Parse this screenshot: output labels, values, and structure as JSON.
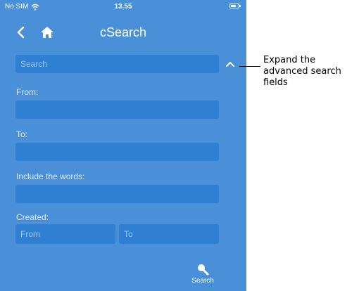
{
  "status_bar": {
    "carrier": "No SIM",
    "time": "13.55"
  },
  "nav": {
    "title": "cSearch"
  },
  "search": {
    "placeholder": "Search"
  },
  "form": {
    "from_label": "From:",
    "to_label": "To:",
    "include_label": "Include the words:",
    "created_label": "Created:",
    "created_from_placeholder": "From",
    "created_to_placeholder": "To"
  },
  "toolbar": {
    "search_label": "Search"
  },
  "annotation": {
    "callout_text": "Expand the advanced search fields"
  },
  "icons": {
    "wifi": "wifi-icon",
    "battery": "battery-icon",
    "back": "chevron-left-icon",
    "home": "home-icon",
    "expand": "chevron-up-icon",
    "search": "search-icon"
  },
  "colors": {
    "background": "#4a90d9",
    "field": "#2f7fd3",
    "text": "#ffffff"
  }
}
